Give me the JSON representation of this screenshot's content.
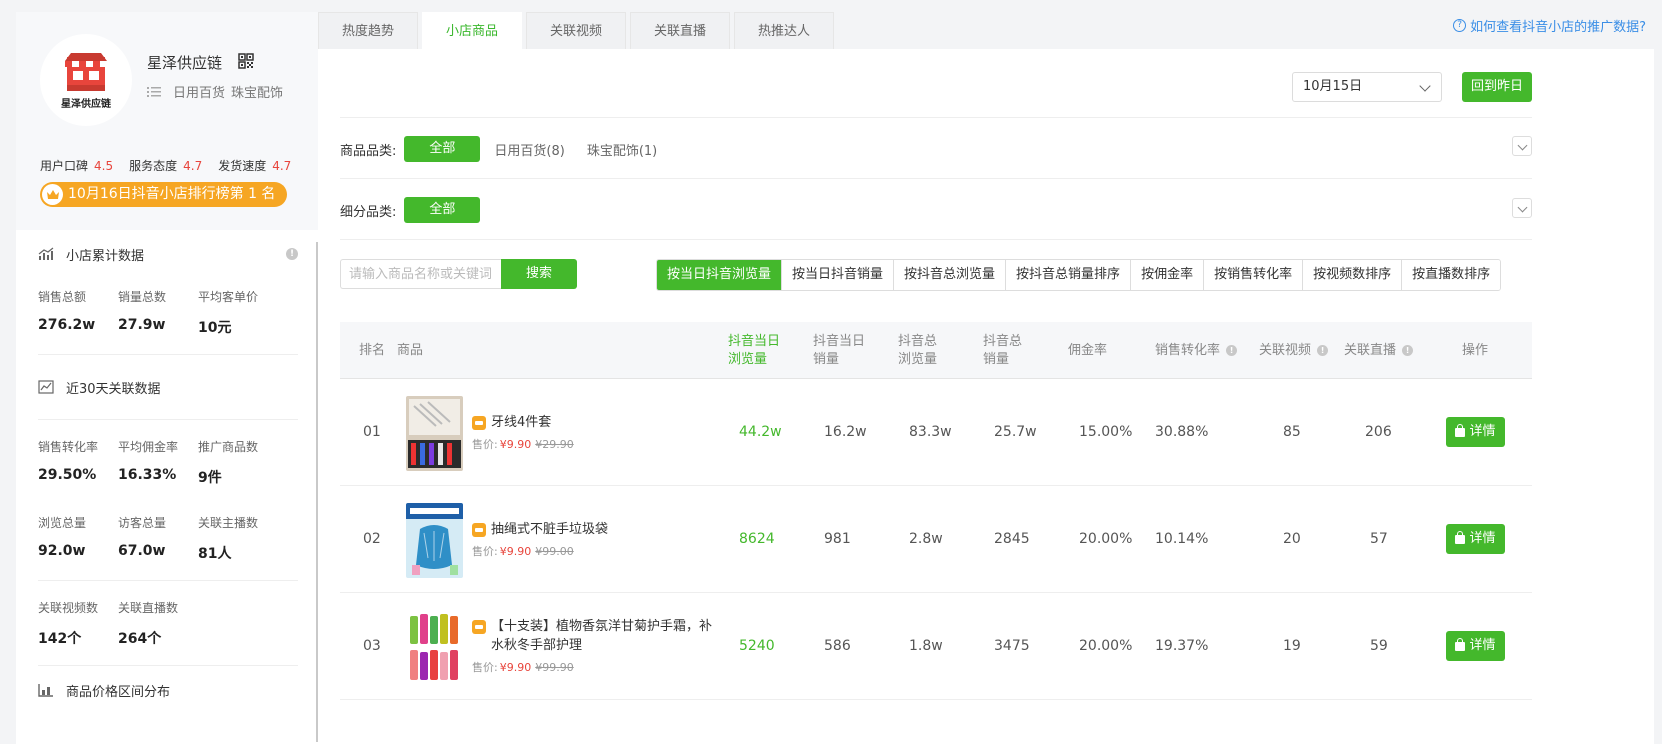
{
  "shop": {
    "name": "星泽供应链",
    "logo_text": "星泽供应链",
    "categories": [
      "日用百货",
      "珠宝配饰"
    ],
    "ratings": [
      {
        "label": "用户口碑",
        "value": "4.5"
      },
      {
        "label": "服务态度",
        "value": "4.7"
      },
      {
        "label": "发货速度",
        "value": "4.7"
      }
    ],
    "rank_badge": "10月16日抖音小店排行榜第 1 名"
  },
  "sidebar": {
    "section1_title": "小店累计数据",
    "section1_stats": [
      {
        "label": "销售总额",
        "value": "276.2w"
      },
      {
        "label": "销量总数",
        "value": "27.9w"
      },
      {
        "label": "平均客单价",
        "value": "10元"
      }
    ],
    "section2_title": "近30天关联数据",
    "section2_stats": [
      {
        "label": "销售转化率",
        "value": "29.50%"
      },
      {
        "label": "平均佣金率",
        "value": "16.33%"
      },
      {
        "label": "推广商品数",
        "value": "9件"
      },
      {
        "label": "浏览总量",
        "value": "92.0w"
      },
      {
        "label": "访客总量",
        "value": "67.0w"
      },
      {
        "label": "关联主播数",
        "value": "81人"
      },
      {
        "label": "关联视频数",
        "value": "142个"
      },
      {
        "label": "关联直播数",
        "value": "264个"
      }
    ],
    "section3_title": "商品价格区间分布"
  },
  "tabs": [
    {
      "label": "热度趋势",
      "active": false
    },
    {
      "label": "小店商品",
      "active": true
    },
    {
      "label": "关联视频",
      "active": false
    },
    {
      "label": "关联直播",
      "active": false
    },
    {
      "label": "热推达人",
      "active": false
    }
  ],
  "help_link": "如何查看抖音小店的推广数据?",
  "date_select": "10月15日",
  "back_button": "回到昨日",
  "filter_category": {
    "label": "商品品类:",
    "active": "全部",
    "options": [
      "日用百货(8)",
      "珠宝配饰(1)"
    ]
  },
  "filter_subcategory": {
    "label": "细分品类:",
    "active": "全部"
  },
  "search": {
    "placeholder": "请输入商品名称或关键词",
    "button": "搜索"
  },
  "sort_buttons": [
    {
      "label": "按当日抖音浏览量",
      "active": true
    },
    {
      "label": "按当日抖音销量",
      "active": false
    },
    {
      "label": "按抖音总浏览量",
      "active": false
    },
    {
      "label": "按抖音总销量排序",
      "active": false
    },
    {
      "label": "按佣金率",
      "active": false
    },
    {
      "label": "按销售转化率",
      "active": false
    },
    {
      "label": "按视频数排序",
      "active": false
    },
    {
      "label": "按直播数排序",
      "active": false
    }
  ],
  "table": {
    "headers": {
      "rank": "排名",
      "product": "商品",
      "daily_views_1": "抖音当日",
      "daily_views_2": "浏览量",
      "daily_sales_1": "抖音当日",
      "daily_sales_2": "销量",
      "total_views_1": "抖音总",
      "total_views_2": "浏览量",
      "total_sales_1": "抖音总",
      "total_sales_2": "销量",
      "commission": "佣金率",
      "conversion": "销售转化率",
      "videos": "关联视频",
      "lives": "关联直播",
      "action": "操作"
    },
    "price_label": "售价:",
    "detail_label": "详情",
    "rows": [
      {
        "rank": "01",
        "name": "牙线4件套",
        "price": "¥9.90",
        "original": "¥29.90",
        "daily_views": "44.2w",
        "daily_sales": "16.2w",
        "total_views": "83.3w",
        "total_sales": "25.7w",
        "commission": "15.00%",
        "conversion": "30.88%",
        "videos": "85",
        "lives": "206"
      },
      {
        "rank": "02",
        "name": "抽绳式不脏手垃圾袋",
        "price": "¥9.90",
        "original": "¥99.00",
        "daily_views": "8624",
        "daily_sales": "981",
        "total_views": "2.8w",
        "total_sales": "2845",
        "commission": "20.00%",
        "conversion": "10.14%",
        "videos": "20",
        "lives": "57"
      },
      {
        "rank": "03",
        "name": "【十支装】植物香氛洋甘菊护手霜，补水秋冬手部护理",
        "price": "¥9.90",
        "original": "¥99.90",
        "daily_views": "5240",
        "daily_sales": "586",
        "total_views": "1.8w",
        "total_sales": "3475",
        "commission": "20.00%",
        "conversion": "19.37%",
        "videos": "19",
        "lives": "59"
      }
    ]
  },
  "colors": {
    "accent": "#44b82c",
    "price": "#e8453c",
    "badge": "#f6a623",
    "link": "#3a8ee6"
  }
}
